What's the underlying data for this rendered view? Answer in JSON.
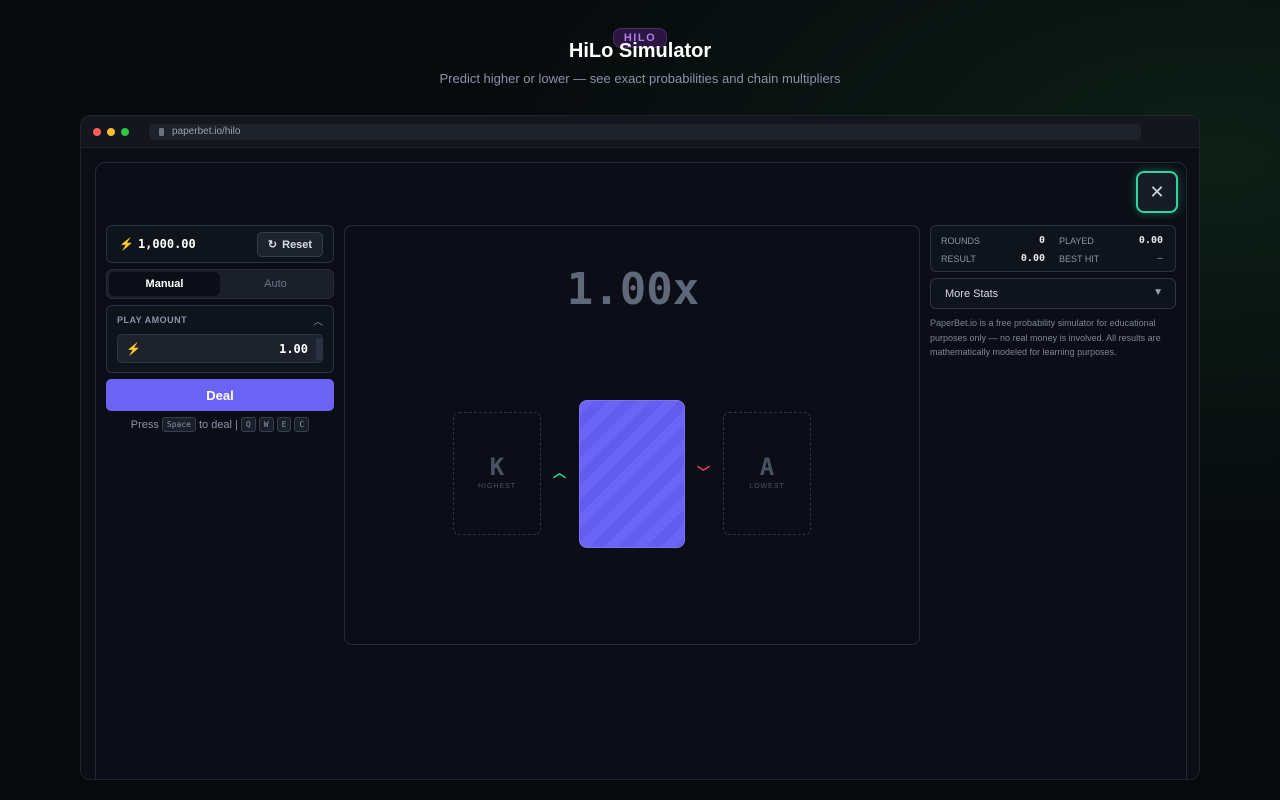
{
  "hero": {
    "badge": "HILO",
    "title": "HiLo Simulator",
    "subtitle": "Predict higher or lower — see exact probabilities and chain multipliers"
  },
  "browser": {
    "url": "paperbet.io/hilo",
    "dot_colors": [
      "#ff5f57",
      "#febc2e",
      "#28c840"
    ]
  },
  "balance": {
    "value": "1,000.00",
    "reset_label": "Reset"
  },
  "mode_tabs": [
    {
      "label": "Manual",
      "active": true
    },
    {
      "label": "Auto",
      "active": false
    }
  ],
  "play_amount": {
    "label": "PLAY AMOUNT",
    "value": "1.00"
  },
  "deal": {
    "label": "Deal",
    "hint_prefix": "Press",
    "hint_key": "Space",
    "hint_suffix": "to deal |",
    "shortcut_keys": [
      "Q",
      "W",
      "E",
      "C"
    ]
  },
  "game": {
    "multiplier": "1.00x",
    "higher_card": {
      "rank": "K",
      "label": "HIGHEST"
    },
    "lower_card": {
      "rank": "A",
      "label": "LOWEST"
    },
    "higher_color": "#2bd9a0",
    "lower_color": "#e5484d"
  },
  "stats": {
    "rounds_label": "ROUNDS",
    "rounds": "0",
    "played_label": "PLAYED",
    "played": "0.00",
    "result_label": "RESULT",
    "result": "0.00",
    "best_hit_label": "BEST HIT",
    "best_hit": "—"
  },
  "more_stats": {
    "label": "More Stats"
  },
  "disclaimer": "PaperBet.io is a free probability simulator for educational purposes only — no real money is involved. All results are mathematically modeled for learning purposes.",
  "colors": {
    "accent": "#6a63f4",
    "close_ring": "#2bd9a0"
  }
}
